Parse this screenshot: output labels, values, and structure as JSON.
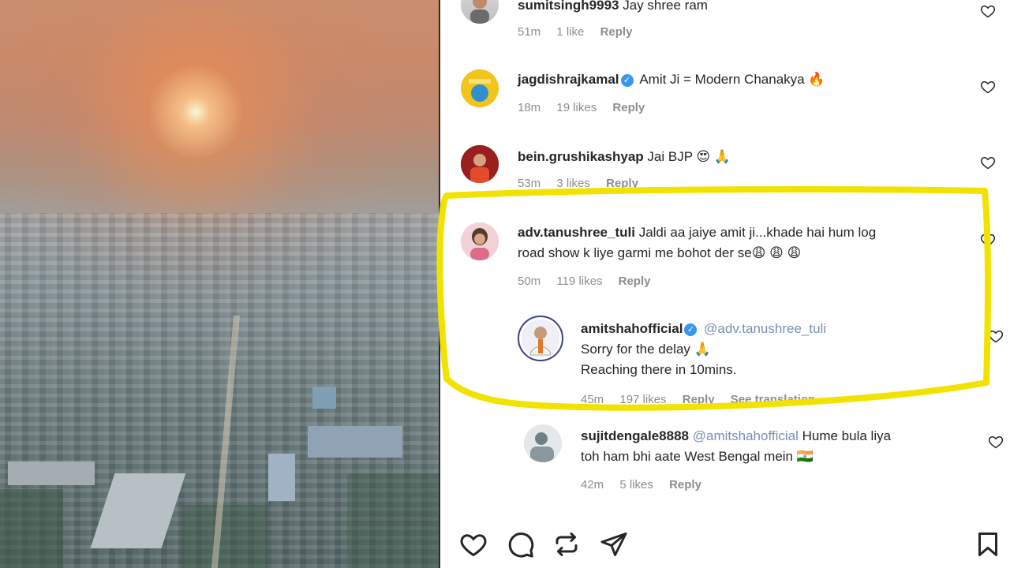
{
  "comments": [
    {
      "username": "sumitsingh9993",
      "text": "Jay shree ram",
      "time": "51m",
      "likes": "1 like",
      "reply": "Reply"
    },
    {
      "username": "jagdishrajkamal",
      "text": "Amit Ji = Modern Chanakya 🔥",
      "time": "18m",
      "likes": "19 likes",
      "reply": "Reply"
    },
    {
      "username": "bein.grushikashyap",
      "text": "Jai BJP 😍 🙏",
      "time": "53m",
      "likes": "3 likes",
      "reply": "Reply"
    },
    {
      "username": "adv.tanushree_tuli",
      "text_line1": "Jaldi aa jaiye amit ji...khade hai hum log",
      "text_line2": "road show k liye garmi me bohot der se😩 😩 😩",
      "time": "50m",
      "likes": "119 likes",
      "reply": "Reply"
    }
  ],
  "reply_main": {
    "username": "amitshahofficial",
    "mention": "@adv.tanushree_tuli",
    "text_line1": "Sorry for the delay 🙏",
    "text_line2": "Reaching there in 10mins.",
    "time": "45m",
    "likes": "197 likes",
    "reply": "Reply",
    "translation": "See translation"
  },
  "reply_second": {
    "username": "sujitdengale8888",
    "mention": "@amitshahofficial",
    "text_line1": "Hume bula liya",
    "text_line2": "toh ham bhi aate West Bengal mein 🇮🇳",
    "time": "42m",
    "likes": "5 likes",
    "reply": "Reply"
  },
  "colors": {
    "highlight": "#f2e200",
    "verified": "#3897f0",
    "meta": "#8e8e8e",
    "mention": "#7a8fb5"
  },
  "icons": {
    "like": "heart-icon",
    "comment": "comment-icon",
    "share": "repost-icon",
    "send": "send-icon",
    "save": "bookmark-icon"
  }
}
